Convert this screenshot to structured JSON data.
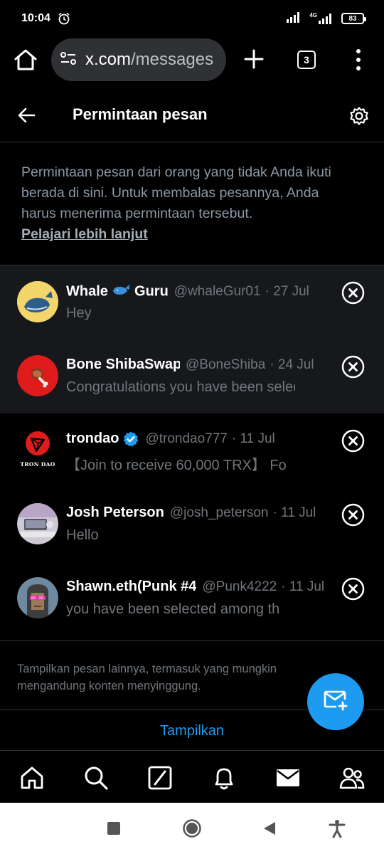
{
  "status_bar": {
    "time": "10:04",
    "network": "4G",
    "battery": "83"
  },
  "browser": {
    "url_host": "x.com",
    "url_path": "/messages",
    "tab_count": "3"
  },
  "header": {
    "title": "Permintaan pesan"
  },
  "info": {
    "text": "Permintaan pesan dari orang yang tidak Anda ikuti berada di sini. Untuk membalas pesannya, Anda harus menerima permintaan tersebut.",
    "link": "Pelajari lebih lanjut"
  },
  "messages": [
    {
      "name_a": "Whale ",
      "name_b": " Guru",
      "handle": "@whaleGur01",
      "date": "· 27 Jul",
      "text": "Hey",
      "verified": false
    },
    {
      "name": "Bone ShibaSwap",
      "handle": "@BoneShiba",
      "date": "· 24 Jul",
      "text": "Congratulations you have been selected",
      "verified": false
    },
    {
      "name": "trondao",
      "handle": "@trondao777",
      "date": "· 11 Jul",
      "text": "【Join to receive 60,000 TRX】 Fo",
      "verified": true,
      "avatar_text": "TRON DAO"
    },
    {
      "name": "Josh Peterson",
      "handle": "@josh_peterson",
      "date": "· 11 Jul",
      "text": "Hello",
      "verified": false
    },
    {
      "name": "Shawn.eth(Punk #4",
      "handle": "@Punk4222",
      "date": "· 11 Jul",
      "text": "you have been selected among th",
      "verified": false
    }
  ],
  "more": {
    "text": "Tampilkan pesan lainnya, termasuk yang mungkin mengandung konten menyinggung.",
    "button": "Tampilkan"
  },
  "colors": {
    "accent": "#1d9bf0",
    "background": "#000000",
    "highlight_row": "#16181c",
    "muted_text": "#71767b"
  },
  "icons": {
    "bottom_nav": [
      "home-icon",
      "search-icon",
      "grok-icon",
      "notifications-icon",
      "messages-icon",
      "communities-icon"
    ],
    "system_nav": [
      "recents-icon",
      "home-circle-icon",
      "back-triangle-icon",
      "accessibility-icon"
    ]
  }
}
